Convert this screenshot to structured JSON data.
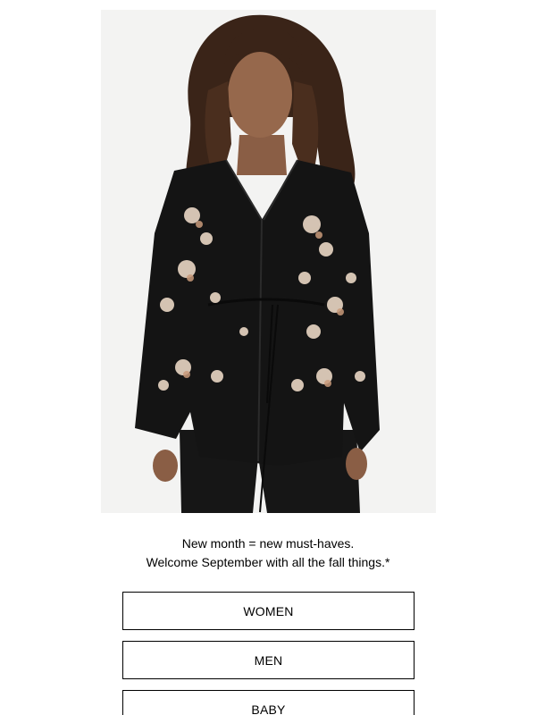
{
  "hero": {
    "image_alt": "Model wearing a black floral print kimono jacket"
  },
  "copy": {
    "line1": "New month = new must-haves.",
    "line2": "Welcome September with all the fall things.*"
  },
  "buttons": {
    "women": "WOMEN",
    "men": "MEN",
    "baby": "BABY"
  },
  "colors": {
    "background": "#ffffff",
    "text": "#000000",
    "button_border": "#000000",
    "hero_backdrop": "#f3f3f2"
  }
}
